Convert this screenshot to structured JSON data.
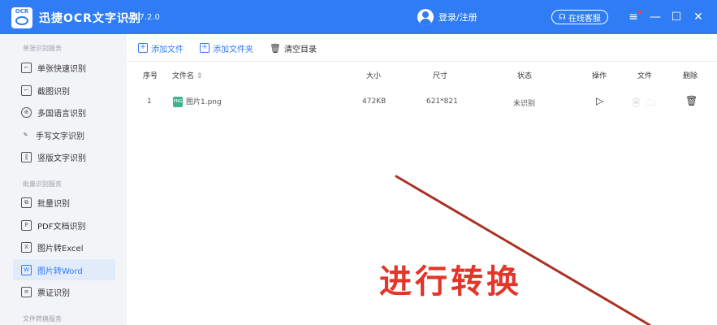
{
  "app": {
    "logo_text": "OCR",
    "title": "迅捷OCR文字识别",
    "version": "v8.7.2.0",
    "login": "登录/注册",
    "service": "在线客服",
    "colors": {
      "brand": "#2f7cf5",
      "annotation": "#e2362a"
    }
  },
  "sidebar": {
    "sections": [
      {
        "title": "单张识别服务",
        "items": [
          "单张快速识别",
          "截图识别",
          "多国语言识别",
          "手写文字识别",
          "竖版文字识别"
        ]
      },
      {
        "title": "批量识别服务",
        "items": [
          "批量识别",
          "PDF文档识别",
          "图片转Excel",
          "图片转Word",
          "票证识别"
        ]
      },
      {
        "title": "文件转换服务",
        "items": []
      }
    ],
    "active_item": "图片转Word"
  },
  "toolbar": {
    "add_file": "添加文件",
    "add_folder": "添加文件夹",
    "clear": "清空目录"
  },
  "table": {
    "headers": [
      "序号",
      "文件名",
      "大小",
      "尺寸",
      "状态",
      "操作",
      "文件",
      "删除"
    ],
    "rows": [
      {
        "index": "1",
        "name": "图片1.png",
        "size": "472KB",
        "dims": "621*821",
        "status": "未识别"
      }
    ]
  },
  "annotation": "进行转换"
}
